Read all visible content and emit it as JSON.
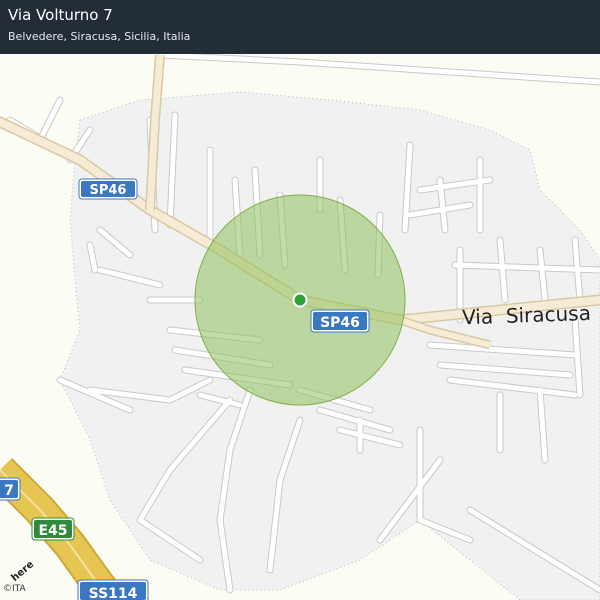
{
  "header": {
    "title": "Via Volturno 7",
    "subtitle": "Belvedere, Siracusa, Sicilia, Italia"
  },
  "map": {
    "colors": {
      "background": "#fbfcf4",
      "urban_area": "#f1f1f1",
      "road": "#ffffff",
      "road_casing": "#c9c9c9",
      "main_road": "#f6ecd6",
      "highway": "#e7c553",
      "accuracy_circle": "#8fbf5b",
      "location_dot": "#2fa33b"
    },
    "shields": [
      {
        "text": "SP46",
        "color": "#3b78c2"
      },
      {
        "text": "SP46",
        "color": "#3b78c2"
      },
      {
        "text": "E45",
        "color": "#2e8b3a"
      },
      {
        "text": "SS114",
        "color": "#3b78c2"
      },
      {
        "text": "7",
        "color": "#3b78c2"
      }
    ],
    "street_label": "Via  Siracusa",
    "location_icon": "location-dot-icon",
    "attribution": "©ITA",
    "logo": "here"
  }
}
